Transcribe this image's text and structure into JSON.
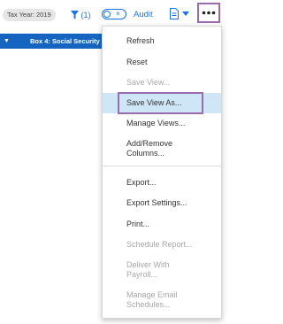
{
  "toolbar": {
    "tax_year_chip": "Tax Year: 2019",
    "filter_count": "(1)",
    "audit_label": "Audit"
  },
  "grid": {
    "column_header": "Box 4: Social Security"
  },
  "menu": {
    "items": [
      {
        "label": "Refresh",
        "enabled": true
      },
      {
        "label": "Reset",
        "enabled": true
      },
      {
        "label": "Save View...",
        "enabled": false
      },
      {
        "label": "Save View As...",
        "enabled": true,
        "highlighted": true
      },
      {
        "label": "Manage Views...",
        "enabled": true
      },
      {
        "label": "Add/Remove Columns...",
        "enabled": true
      },
      {
        "label": "Export...",
        "enabled": true
      },
      {
        "label": "Export Settings...",
        "enabled": true
      },
      {
        "label": "Print...",
        "enabled": true
      },
      {
        "label": "Schedule Report...",
        "enabled": false
      },
      {
        "label": "Deliver With Payroll...",
        "enabled": false
      },
      {
        "label": "Manage Email Schedules...",
        "enabled": false
      }
    ]
  },
  "colors": {
    "accent": "#1a73e8",
    "header_blue": "#1565c0",
    "highlight_border": "#9b6bb0",
    "hover_bg": "#cfe6f7",
    "disabled_text": "#a8a8a8"
  },
  "icons": [
    "filter-icon",
    "toggle-switch",
    "document-icon",
    "chevron-down-icon",
    "more-dots-icon"
  ]
}
